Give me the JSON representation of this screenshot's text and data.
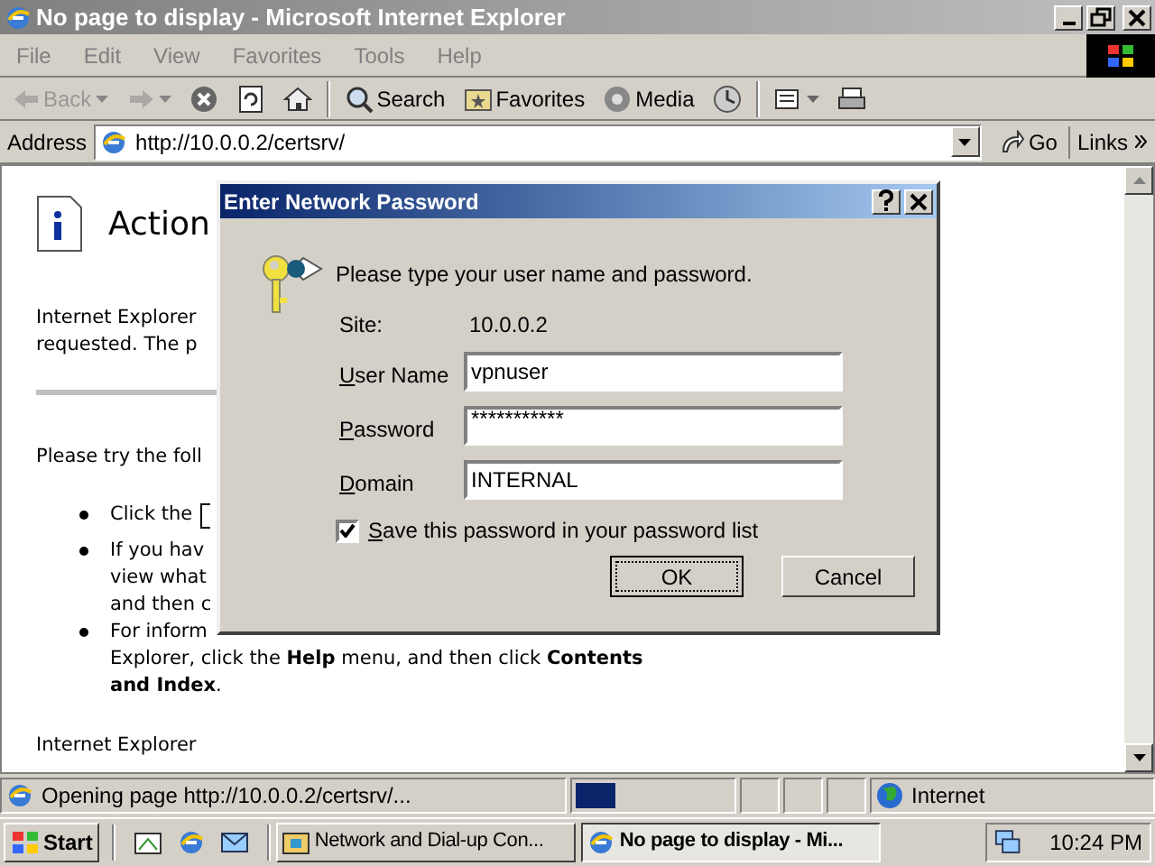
{
  "window": {
    "title": "No page to display - Microsoft Internet Explorer"
  },
  "menu": [
    "File",
    "Edit",
    "View",
    "Favorites",
    "Tools",
    "Help"
  ],
  "toolbar": [
    {
      "kind": "back",
      "label": "Back",
      "disabled": true
    },
    {
      "kind": "forward",
      "disabled": true
    },
    {
      "kind": "stop",
      "disabled": false
    },
    {
      "kind": "refresh",
      "disabled": false
    },
    {
      "kind": "home",
      "disabled": false
    },
    {
      "kind": "search",
      "label": "Search",
      "disabled": false
    },
    {
      "kind": "favorites",
      "label": "Favorites",
      "disabled": false
    },
    {
      "kind": "media",
      "label": "Media",
      "disabled": false
    },
    {
      "kind": "history",
      "disabled": false
    },
    {
      "kind": "mail",
      "disabled": false
    },
    {
      "kind": "print",
      "disabled": false
    }
  ],
  "address": {
    "label": "Address",
    "value": "http://10.0.0.2/certsrv/",
    "go": "Go",
    "links": "Links"
  },
  "page": {
    "heading": "Action",
    "paragraphs": [
      "Internet Explorer",
      "requested. The p"
    ],
    "try": "Please try the foll",
    "bullets": [
      {
        "lines": [
          "Click the"
        ],
        "button": true
      },
      {
        "lines": [
          "If you hav",
          "view what",
          "and then c"
        ],
        "button": false
      },
      {
        "lines": [
          "For inform",
          "Explorer, click the **Help** menu, and then click **Contents**",
          "**and Index**."
        ],
        "button": false
      }
    ],
    "footer": "Internet Explorer"
  },
  "dialog": {
    "title": "Enter Network Password",
    "prompt": "Please type your user name and password.",
    "site_label": "Site:",
    "site": "10.0.0.2",
    "fields": [
      {
        "label": "User Name",
        "value": "vpnuser"
      },
      {
        "label": "Password",
        "value": "***********"
      },
      {
        "label": "Domain",
        "value": "INTERNAL"
      }
    ],
    "save": {
      "label": "Save this password in your password list",
      "checked": true
    },
    "buttons": [
      {
        "label": "OK",
        "default": true
      },
      {
        "label": "Cancel",
        "default": false
      }
    ]
  },
  "status": {
    "text": "Opening page http://10.0.0.2/certsrv/...",
    "level": 0.25,
    "zone": "Internet"
  },
  "taskbar": {
    "start": "Start",
    "tasks": [
      {
        "label": "Network and Dial-up Con...",
        "selected": false
      },
      {
        "label": "No page to display - Mi...",
        "selected": true
      }
    ],
    "clock": "10:24 PM"
  }
}
